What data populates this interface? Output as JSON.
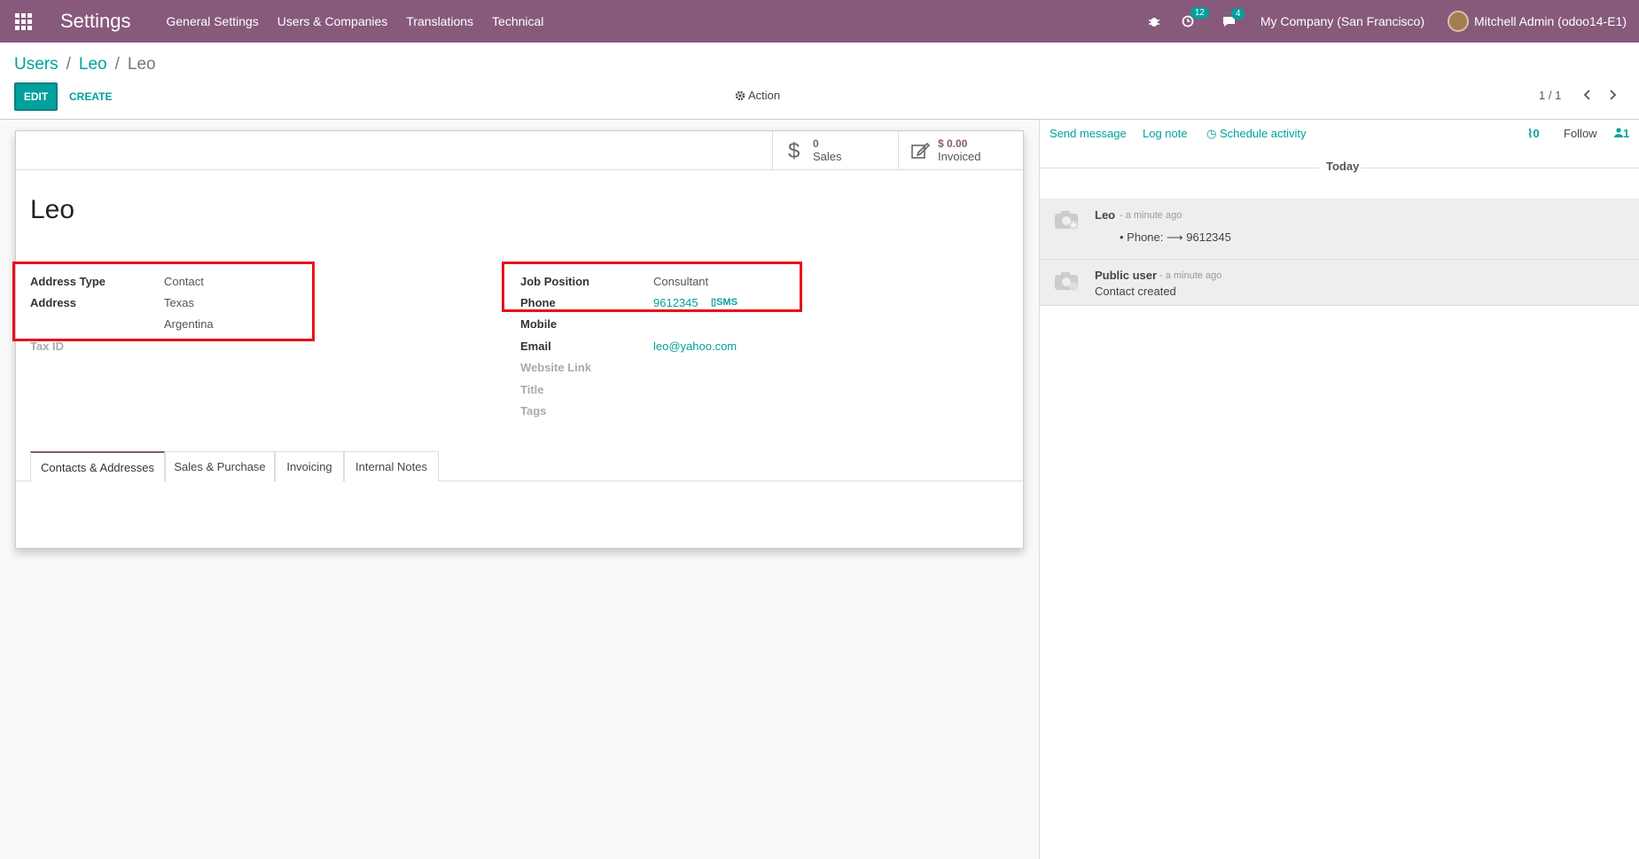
{
  "navbar": {
    "app_title": "Settings",
    "menu": [
      "General Settings",
      "Users & Companies",
      "Translations",
      "Technical"
    ],
    "activity_count": "12",
    "message_count": "4",
    "company": "My Company (San Francisco)",
    "user": "Mitchell Admin (odoo14-E1)",
    "bg_color": "#875A7B"
  },
  "control": {
    "breadcrumb": [
      "Users",
      "Leo",
      "Leo"
    ],
    "edit_label": "EDIT",
    "create_label": "CREATE",
    "action_label": "Action",
    "pager": "1 / 1"
  },
  "form": {
    "stats": {
      "sales_value": "0",
      "sales_label": "Sales",
      "invoiced_value": "$ 0.00",
      "invoiced_label": "Invoiced"
    },
    "name": "Leo",
    "left": {
      "address_type_label": "Address Type",
      "address_type_value": "Contact",
      "address_label": "Address",
      "address_line1": "Texas",
      "address_line2": "Argentina",
      "tax_id_label": "Tax ID"
    },
    "right": {
      "job_position_label": "Job Position",
      "job_position_value": "Consultant",
      "phone_label": "Phone",
      "phone_value": "9612345",
      "sms_label": "SMS",
      "mobile_label": "Mobile",
      "email_label": "Email",
      "email_value": "leo@yahoo.com",
      "website_label": "Website Link",
      "title_label": "Title",
      "tags_label": "Tags"
    },
    "tabs": [
      "Contacts & Addresses",
      "Sales & Purchase",
      "Invoicing",
      "Internal Notes"
    ]
  },
  "chatter": {
    "send_message": "Send message",
    "log_note": "Log note",
    "schedule_activity": "Schedule activity",
    "attachments_count": "0",
    "follow": "Follow",
    "followers_count": "1",
    "date_separator": "Today",
    "messages": [
      {
        "author": "Leo",
        "date": "- a minute ago",
        "body_prefix": "Phone: ",
        "body_value": "9612345"
      },
      {
        "author": "Public user",
        "date": "- a minute ago",
        "body": "Contact created"
      }
    ]
  },
  "colors": {
    "primary": "#875A7B",
    "accent": "#00A09D",
    "highlight_box": "#e8101a"
  }
}
